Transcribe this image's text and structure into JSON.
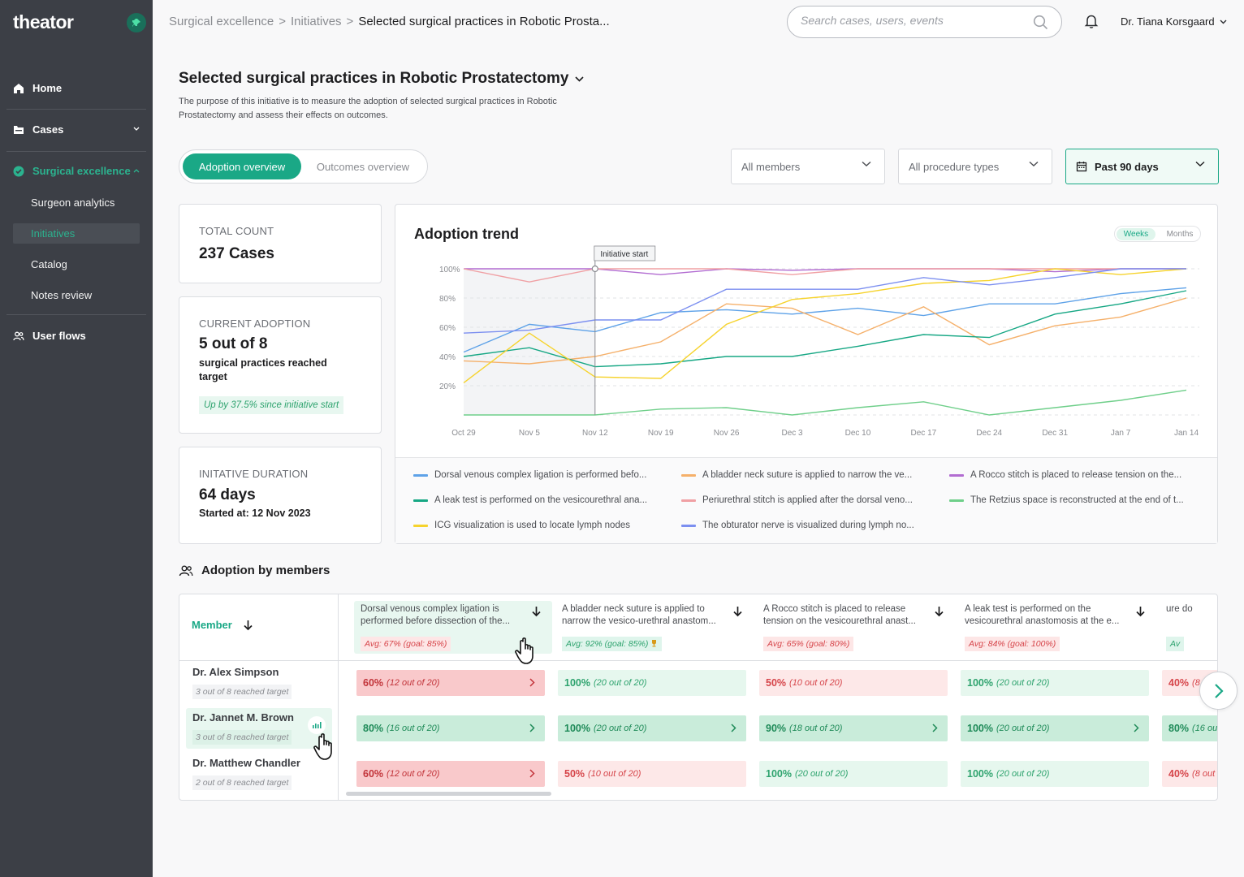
{
  "app": {
    "logo": "theator"
  },
  "sidebar": {
    "items": [
      {
        "label": "Home"
      },
      {
        "label": "Cases"
      },
      {
        "label": "Surgical excellence"
      },
      {
        "label": "User flows"
      }
    ],
    "sub_items": [
      {
        "label": "Surgeon analytics"
      },
      {
        "label": "Initiatives"
      },
      {
        "label": "Catalog"
      },
      {
        "label": "Notes review"
      }
    ]
  },
  "breadcrumb": {
    "items": [
      "Surgical excellence",
      "Initiatives",
      "Selected surgical practices in Robotic Prosta..."
    ],
    "sep": ">"
  },
  "search": {
    "placeholder": "Search cases, users, events"
  },
  "user": {
    "name": "Dr. Tiana Korsgaard"
  },
  "page": {
    "title": "Selected surgical practices in Robotic Prostatectomy",
    "description": "The purpose of this initiative is to measure the adoption of selected surgical practices in Robotic Prostatectomy and assess their effects on outcomes."
  },
  "tabs": {
    "active": "Adoption overview",
    "inactive": "Outcomes overview"
  },
  "filters": {
    "members": "All members",
    "procedure": "All procedure types",
    "date": "Past 90 days"
  },
  "stats": {
    "total": {
      "label": "TOTAL COUNT",
      "value": "237 Cases"
    },
    "adoption": {
      "label": "CURRENT ADOPTION",
      "value": "5 out of 8",
      "sub": "surgical practices reached target",
      "badge": "Up by 37.5% since initiative start"
    },
    "duration": {
      "label": "INITATIVE DURATION",
      "value": "64 days",
      "sub": "Started at: 12 Nov 2023"
    }
  },
  "chart": {
    "title": "Adoption trend",
    "toggle": {
      "weeks": "Weeks",
      "months": "Months"
    },
    "annotation": "Initiative start"
  },
  "chart_data": {
    "type": "line",
    "title": "Adoption trend",
    "x": [
      "Oct 29",
      "Nov 5",
      "Nov 12",
      "Nov 19",
      "Nov 26",
      "Dec 3",
      "Dec 10",
      "Dec 17",
      "Dec 24",
      "Dec 31",
      "Jan 7",
      "Jan 14"
    ],
    "y_ticks": [
      "100%",
      "80%",
      "60%",
      "40%",
      "20%"
    ],
    "ylim": [
      0,
      100
    ],
    "grid": true,
    "series": [
      {
        "name": "Dorsal venous complex ligation is performed befo...",
        "color": "#5ea2e8",
        "values": [
          43,
          62,
          57,
          70,
          72,
          69,
          73,
          68,
          76,
          76,
          83,
          87
        ]
      },
      {
        "name": "A bladder neck suture is applied to narrow the ve...",
        "color": "#f5b06a",
        "values": [
          37,
          35,
          40,
          50,
          76,
          73,
          55,
          74,
          48,
          61,
          67,
          80
        ]
      },
      {
        "name": "A Rocco stitch is placed to release tension on the...",
        "color": "#b26cd1",
        "values": [
          100,
          100,
          100,
          96,
          100,
          99,
          100,
          100,
          100,
          98,
          100,
          100
        ]
      },
      {
        "name": "A leak test is performed on the vesicourethral ana...",
        "color": "#16a784",
        "values": [
          40,
          46,
          33,
          35,
          40,
          40,
          47,
          55,
          53,
          69,
          76,
          85
        ]
      },
      {
        "name": "Periurethral stitch is applied after the dorsal veno...",
        "color": "#f0a0a4",
        "values": [
          100,
          91,
          100,
          100,
          100,
          96,
          100,
          100,
          100,
          100,
          100,
          100
        ]
      },
      {
        "name": "The Retzius space is reconstructed at the end of t...",
        "color": "#6fcf8a",
        "values": [
          0,
          0,
          0,
          4,
          5,
          0,
          5,
          9,
          0,
          5,
          10,
          17
        ]
      },
      {
        "name": "ICG visualization is used to locate lymph nodes",
        "color": "#f6d32d",
        "values": [
          22,
          56,
          26,
          25,
          62,
          79,
          83,
          90,
          92,
          100,
          96,
          100
        ]
      },
      {
        "name": "The obturator nerve is visualized during lymph no...",
        "color": "#7c8ff0",
        "values": [
          56,
          58,
          65,
          65,
          86,
          86,
          86,
          94,
          89,
          94,
          100,
          100
        ]
      }
    ]
  },
  "members_section": {
    "title": "Adoption by members",
    "member_header": "Member",
    "columns": [
      {
        "text": "Dorsal venous complex ligation is performed before dissection of the...",
        "avg": "Avg: 67% (goal: 85%)",
        "avg_status": "red",
        "trophy": false
      },
      {
        "text": "A bladder neck suture is applied to narrow the vesico-urethral anastom...",
        "avg": "Avg: 92% (goal: 85%)",
        "avg_status": "green",
        "trophy": true
      },
      {
        "text": "A Rocco stitch is placed to release tension on the vesicourethral anast...",
        "avg": "Avg: 65% (goal: 80%)",
        "avg_status": "red",
        "trophy": false
      },
      {
        "text": "A leak test is performed on the vesicourethral anastomosis at the e...",
        "avg": "Avg: 84% (goal: 100%)",
        "avg_status": "red",
        "trophy": false
      },
      {
        "text": "ure do",
        "avg": "Av",
        "avg_status": "green",
        "trophy": false
      }
    ],
    "members": [
      {
        "name": "Dr. Alex Simpson",
        "target": "3 out of 8 reached target",
        "cells": [
          {
            "pct": "60%",
            "count": "(12 out of 20)",
            "style": "red-strong",
            "arrow": true
          },
          {
            "pct": "100%",
            "count": "(20 out of 20)",
            "style": "green-light",
            "arrow": false
          },
          {
            "pct": "50%",
            "count": "(10 out of 20)",
            "style": "red-light",
            "arrow": false
          },
          {
            "pct": "100%",
            "count": "(20 out of 20)",
            "style": "green-light",
            "arrow": false
          },
          {
            "pct": "40%",
            "count": "(8 ou",
            "style": "red-light",
            "arrow": false
          }
        ]
      },
      {
        "name": "Dr. Jannet M. Brown",
        "target": "3 out of 8 reached target",
        "cells": [
          {
            "pct": "80%",
            "count": "(16 out of 20)",
            "style": "green-strong",
            "arrow": true
          },
          {
            "pct": "100%",
            "count": "(20 out of 20)",
            "style": "green-strong",
            "arrow": true
          },
          {
            "pct": "90%",
            "count": "(18 out of 20)",
            "style": "green-strong",
            "arrow": true
          },
          {
            "pct": "100%",
            "count": "(20 out of 20)",
            "style": "green-strong",
            "arrow": true
          },
          {
            "pct": "80%",
            "count": "(16 out o",
            "style": "green-strong",
            "arrow": false
          }
        ]
      },
      {
        "name": "Dr. Matthew Chandler",
        "target": "2 out of 8 reached target",
        "cells": [
          {
            "pct": "60%",
            "count": "(12 out of 20)",
            "style": "red-strong",
            "arrow": true
          },
          {
            "pct": "50%",
            "count": "(10 out of 20)",
            "style": "red-light",
            "arrow": false
          },
          {
            "pct": "100%",
            "count": "(20 out of 20)",
            "style": "green-light",
            "arrow": false
          },
          {
            "pct": "100%",
            "count": "(20 out of 20)",
            "style": "green-light",
            "arrow": false
          },
          {
            "pct": "40%",
            "count": "(8 out of",
            "style": "red-light",
            "arrow": false
          }
        ]
      }
    ]
  }
}
